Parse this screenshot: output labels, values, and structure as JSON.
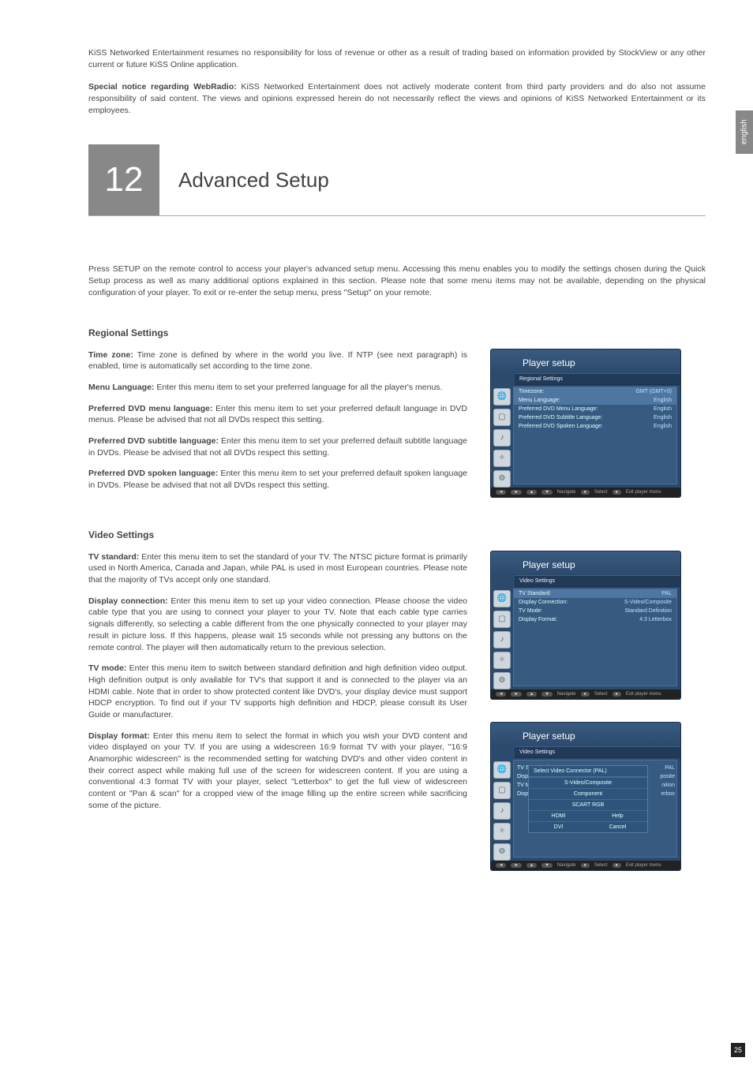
{
  "sideTab": "english",
  "pageNumber": "25",
  "notes": {
    "n1": "KiSS Networked Entertainment resumes no responsibility for loss of revenue or other as a result of trading based on information provided by StockView or any other current or future KiSS Online application.",
    "n2_bold": "Special notice regarding WebRadio:",
    "n2_rest": " KiSS Networked Entertainment does not actively moderate content from third party providers and do also not assume responsibility of said content. The views and opinions expressed herein do not necessarily reflect the views and opinions of KiSS Networked Entertainment or its employees."
  },
  "chapter": {
    "num": "12",
    "title": "Advanced Setup"
  },
  "intro": "Press SETUP on the remote control to access your player's advanced setup menu. Accessing this menu enables you to modify the settings chosen during the Quick Setup process as well as many additional options explained in this section. Please note that some menu items may not be available, depending on the physical configuration of your player. To exit or re-enter the setup menu, press \"Setup\" on your remote.",
  "regional": {
    "heading": "Regional Settings",
    "items": {
      "tz_b": "Time zone:",
      "tz": " Time zone is defined by where in the world you live. If NTP (see next paragraph) is enabled, time is automatically set according to the time zone.",
      "ml_b": "Menu Language:",
      "ml": " Enter this menu item to set your preferred language for all the player's menus.",
      "pdm_b": "Preferred DVD menu language:",
      "pdm": " Enter this menu item to set your preferred default language in DVD menus. Please be advised that not all DVDs respect this setting.",
      "pds_b": "Preferred DVD subtitle language:",
      "pds": " Enter this menu item to set your preferred default subtitle language in DVDs. Please be advised that not all DVDs respect this setting.",
      "pdk_b": "Preferred DVD spoken language:",
      "pdk": " Enter this menu item to set your preferred default spoken language in DVDs. Please be advised that not all DVDs respect this setting."
    }
  },
  "video": {
    "heading": "Video Settings",
    "items": {
      "tvs_b": "TV standard:",
      "tvs": " Enter this menu item to set the standard of your TV. The NTSC picture format is primarily used in North America, Canada and Japan, while PAL is used in most European countries. Please note that the majority of TVs accept only one standard.",
      "dc_b": "Display connection:",
      "dc": " Enter this menu item to set up your video connection. Please choose the video cable type that you are using to connect your player to your TV. Note that each cable type carries signals differently, so selecting a cable different from the one physically connected to your player may result in picture loss. If this happens, please wait 15 seconds while not pressing any buttons on the remote control. The player will then automatically return to the previous selection.",
      "tvm_b": "TV mode:",
      "tvm": " Enter this menu item to switch between standard definition and high definition video output. High definition output is only available for TV's that support it and is connected to the player via an HDMI cable. Note that in order to show protected content like DVD's, your display device must support HDCP encryption. To find out if your TV supports high definition and HDCP, please consult its User Guide or manufacturer.",
      "df_b": "Display format:",
      "df": " Enter this menu item to select the format in which you wish your DVD content and video displayed on your TV. If you are using a widescreen 16:9 format TV with your player, \"16:9 Anamorphic widescreen\" is the recommended setting for watching DVD's and other video content in their correct aspect while making full use of the screen for widescreen content. If you are using a conventional 4:3 format TV with your player, select \"Letterbox\" to get the full view of widescreen content or \"Pan & scan\" for a cropped view of the image filling up the entire screen while sacrificing some of the picture."
    }
  },
  "shots": {
    "title": "Player setup",
    "foot": {
      "nav": "Navigate",
      "sel": "Select",
      "exit": "Exit player menu"
    },
    "s1": {
      "sub": "Regional Settings",
      "rows": [
        {
          "k": "Timezone:",
          "v": "GMT (GMT+0)"
        },
        {
          "k": "Menu Language:",
          "v": "English"
        },
        {
          "k": "Preferred DVD Menu Language:",
          "v": "English"
        },
        {
          "k": "Preferred DVD Subtitle Language:",
          "v": "English"
        },
        {
          "k": "Preferred DVD Spoken Language:",
          "v": "English"
        }
      ]
    },
    "s2": {
      "sub": "Video Settings",
      "rows": [
        {
          "k": "TV Standard:",
          "v": "PAL"
        },
        {
          "k": "Display Connection:",
          "v": "S-Video/Composite"
        },
        {
          "k": "TV Mode:",
          "v": "Standard Definition"
        },
        {
          "k": "Display Format:",
          "v": "4:3 Letterbox"
        }
      ]
    },
    "s3": {
      "sub": "Video Settings",
      "behindK": [
        "TV Standard:",
        "Displa",
        "TV Mo",
        "Displa"
      ],
      "behindV": [
        "PAL",
        "posite",
        "nition",
        "erbox"
      ],
      "popupTitle": "Select Video Connector (PAL)",
      "popupItems": [
        "S-Video/Composite",
        "Component",
        "SCART RGB"
      ],
      "popupRow": [
        [
          "HDMI",
          "Help"
        ],
        [
          "DVI",
          "Cancel"
        ]
      ]
    }
  }
}
